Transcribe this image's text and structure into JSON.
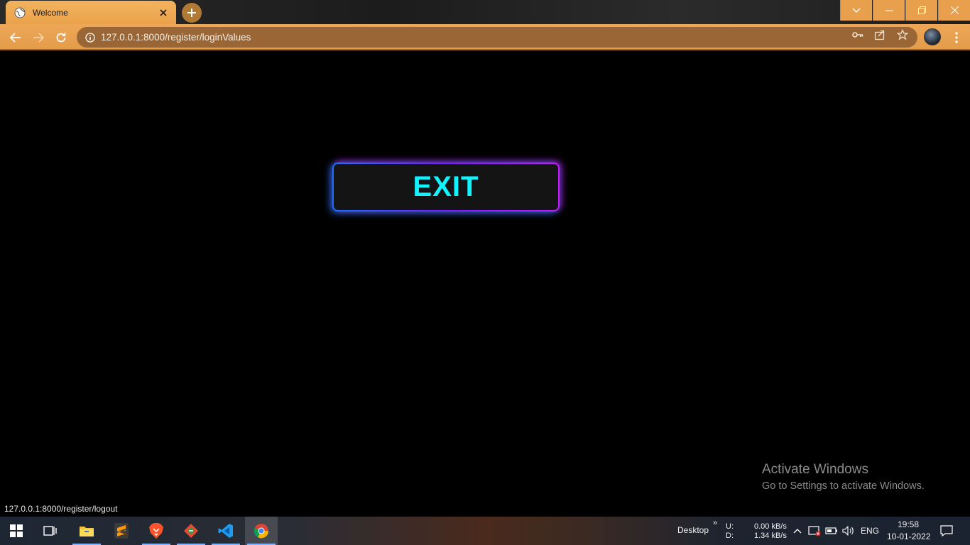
{
  "browser": {
    "tab": {
      "title": "Welcome"
    },
    "address_bar": {
      "url": "127.0.0.1:8000/register/loginValues"
    }
  },
  "page": {
    "exit_button_label": "EXIT",
    "status_url": "127.0.0.1:8000/register/logout",
    "watermark": {
      "title": "Activate Windows",
      "subtitle": "Go to Settings to activate Windows."
    }
  },
  "taskbar": {
    "toolbar_label": "Desktop",
    "chevron": "»",
    "net_upload_label": "U:",
    "net_download_label": "D:",
    "net_upload_speed": "0.00 kB/s",
    "net_download_speed": "1.34 kB/s",
    "language": "ENG",
    "time": "19:58",
    "date": "10-01-2022"
  },
  "colors": {
    "exit_text": "#0ff4ff",
    "browser_accent": "#eda756"
  }
}
